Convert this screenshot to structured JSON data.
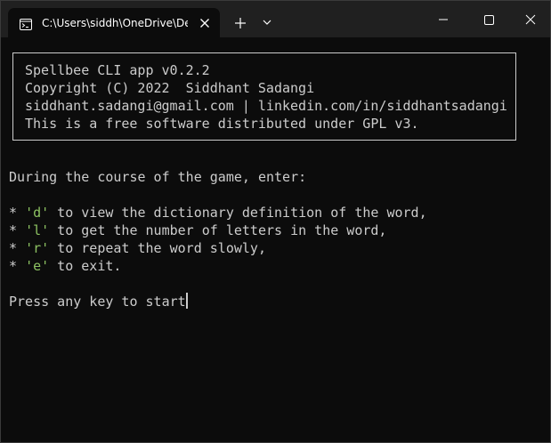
{
  "tab": {
    "title": "C:\\Users\\siddh\\OneDrive\\Des"
  },
  "icons": {
    "tab_icon": "terminal-icon",
    "tab_close": "close-icon",
    "new_tab": "plus-icon",
    "dropdown": "chevron-down-icon",
    "minimize": "minimize-icon",
    "maximize": "maximize-icon",
    "close": "close-icon"
  },
  "colors": {
    "background": "#0c0c0c",
    "titlebar": "#202020",
    "text": "#cccccc",
    "key_highlight": "#8dc262"
  },
  "banner": {
    "lines": [
      "Spellbee CLI app v0.2.2",
      "Copyright (C) 2022  Siddhant Sadangi",
      "siddhant.sadangi@gmail.com | linkedin.com/in/siddhantsadangi",
      "This is a free software distributed under GPL v3."
    ]
  },
  "instructions": {
    "intro": "During the course of the game, enter:",
    "items": [
      {
        "bullet": "* ",
        "key": "'d'",
        "text": " to view the dictionary definition of the word,"
      },
      {
        "bullet": "* ",
        "key": "'l'",
        "text": " to get the number of letters in the word,"
      },
      {
        "bullet": "* ",
        "key": "'r'",
        "text": " to repeat the word slowly,"
      },
      {
        "bullet": "* ",
        "key": "'e'",
        "text": " to exit."
      }
    ]
  },
  "prompt": "Press any key to start"
}
